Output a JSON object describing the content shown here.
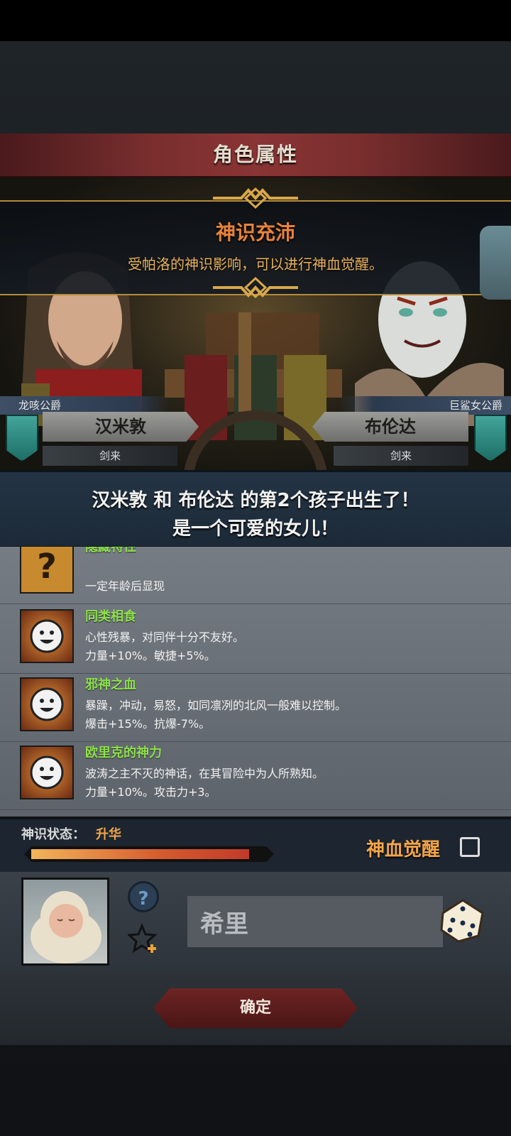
{
  "header": {
    "title": "角色属性"
  },
  "banner": {
    "title": "神识充沛",
    "description": "受帕洛的神识影响，可以进行神血觉醒。"
  },
  "parents": {
    "left": {
      "rank": "龙咳公爵",
      "name": "汉米敦",
      "class": "剑来"
    },
    "right": {
      "rank": "巨鲨女公爵",
      "name": "布伦达",
      "class": "剑来"
    }
  },
  "announcement": {
    "line1": "汉米敦 和 布伦达 的第2个孩子出生了！",
    "line2": "是一个可爱的女儿！"
  },
  "traits": [
    {
      "name": "隐藏特性",
      "line1": "",
      "line2": "一定年龄后显现",
      "icon": "question-icon"
    },
    {
      "name": "同类相食",
      "line1": "心性残暴，对同伴十分不友好。",
      "line2": "力量+10%。敏捷+5%。",
      "icon": "smiley-icon"
    },
    {
      "name": "邪神之血",
      "line1": "暴躁，冲动，易怒，如同凛冽的北风一般难以控制。",
      "line2": "爆击+15%。抗爆-7%。",
      "icon": "smiley-icon"
    },
    {
      "name": "欧里克的神力",
      "line1": "波涛之主不灭的神话，在其冒险中为人所熟知。",
      "line2": "力量+10%。攻击力+3。",
      "icon": "smiley-icon"
    }
  ],
  "divine_status": {
    "label": "神识状态：",
    "value": "升华",
    "progress": 0.96
  },
  "awaken": {
    "label": "神血觉醒",
    "checked": false
  },
  "child": {
    "name_value": "希里"
  },
  "confirm": {
    "label": "确定"
  },
  "colors": {
    "accent_orange": "#f3a54a",
    "trait_green": "#8ee04a",
    "title_red": "#7a2e2e"
  }
}
